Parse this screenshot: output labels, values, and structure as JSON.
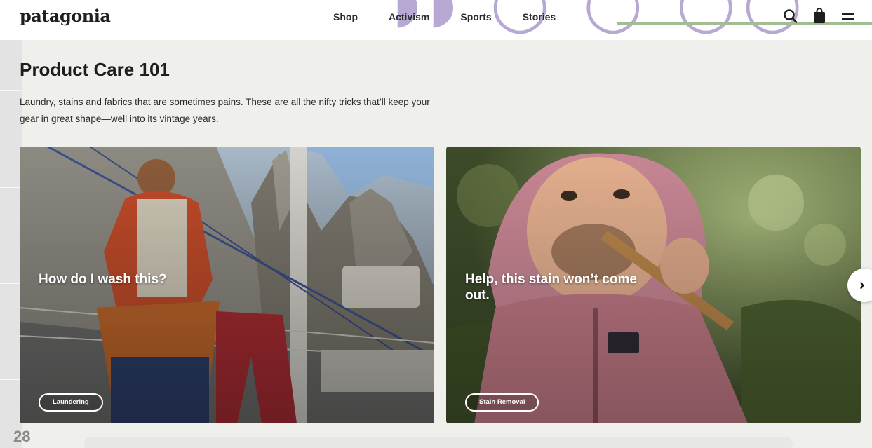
{
  "header": {
    "logo": "patagonia",
    "nav": [
      "Shop",
      "Activism",
      "Sports",
      "Stories"
    ],
    "icons": [
      "search-icon",
      "bag-icon",
      "menu-icon"
    ]
  },
  "page": {
    "number": "28",
    "title": "Product Care 101",
    "description": "Laundry, stains and fabrics that are sometimes pains. These are all the nifty tricks that’ll keep your gear in great shape—well into its vintage years."
  },
  "cards": [
    {
      "title": "How do I wash this?",
      "tag": "Laundering"
    },
    {
      "title": "Help, this stain won’t come out.",
      "tag": "Stain Removal"
    }
  ],
  "carousel": {
    "next_icon": "chevron-right-icon"
  },
  "colors": {
    "background": "#efefeb",
    "header": "#ffffff",
    "accent_green": "#a2bd93",
    "accent_lavender": "#b8a9d4"
  }
}
